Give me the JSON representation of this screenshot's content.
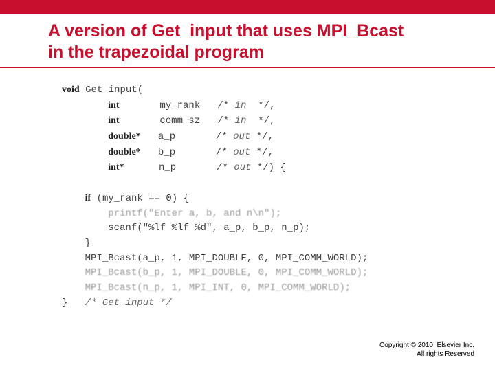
{
  "title": {
    "line1": "A version of Get_input that uses MPI_Bcast",
    "line2": "in the trapezoidal program"
  },
  "code": {
    "sig_kw": "void",
    "sig_fn": "Get_input(",
    "params": [
      {
        "type": "int",
        "name": "my_rank",
        "dir": "in",
        "tail": "*/,"
      },
      {
        "type": "int",
        "name": "comm_sz",
        "dir": "in",
        "tail": "*/,"
      },
      {
        "type": "double*",
        "name": "a_p",
        "dir": "out",
        "tail": "*/,"
      },
      {
        "type": "double*",
        "name": "b_p",
        "dir": "out",
        "tail": "*/,"
      },
      {
        "type": "int*",
        "name": "n_p",
        "dir": "out",
        "tail": "*/) {"
      }
    ],
    "body": {
      "if_kw": "if",
      "if_cond": "(my_rank == 0) {",
      "printf": "printf(\"Enter a, b, and n\\n\");",
      "scanf": "scanf(\"%lf %lf %d\", a_p, b_p, n_p);",
      "close_if": "}",
      "bcast1": "MPI_Bcast(a_p, 1, MPI_DOUBLE, 0, MPI_COMM_WORLD);",
      "bcast2": "MPI_Bcast(b_p, 1, MPI_DOUBLE, 0, MPI_COMM_WORLD);",
      "bcast3": "MPI_Bcast(n_p, 1, MPI_INT, 0, MPI_COMM_WORLD);",
      "end_brace": "}",
      "end_comment": "/* Get input */"
    }
  },
  "footer": {
    "line1": "Copyright © 2010, Elsevier Inc.",
    "line2": "All rights Reserved"
  }
}
